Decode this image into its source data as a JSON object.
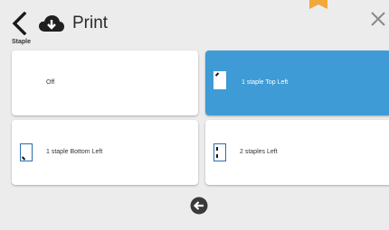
{
  "header": {
    "title": "Print",
    "back_icon": "chevron-left-icon",
    "cloud_icon": "cloud-download-icon",
    "close_icon": "close-icon",
    "flag_color": "#f0a93a"
  },
  "section": {
    "label": "Staple"
  },
  "options": [
    {
      "label": "Off",
      "selected": false,
      "icon": "none"
    },
    {
      "label": "1 staple Top Left",
      "selected": true,
      "icon": "staple-top-left-icon"
    },
    {
      "label": "1 staple Bottom Left",
      "selected": false,
      "icon": "staple-bottom-left-icon"
    },
    {
      "label": "2 staples Left",
      "selected": false,
      "icon": "two-staples-left-icon"
    }
  ],
  "footer": {
    "back_icon": "arrow-left-circle-icon"
  },
  "colors": {
    "accent": "#3f9bd5",
    "background": "#ececec"
  }
}
